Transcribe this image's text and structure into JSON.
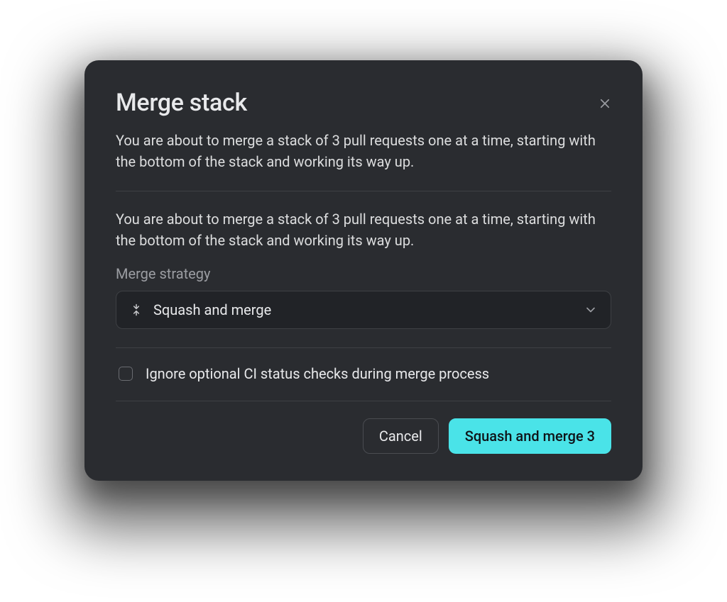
{
  "modal": {
    "title": "Merge stack",
    "description_top": "You are about to merge a stack of 3 pull requests one at a time, starting with the bottom of the stack and working its way up.",
    "description_mid": "You are about to merge a stack of 3 pull requests one at a time, starting with the bottom of the stack and working its way up.",
    "strategy_label": "Merge strategy",
    "strategy_selected": "Squash and merge",
    "checkbox_label": "Ignore optional CI status checks during merge process",
    "cancel_label": "Cancel",
    "confirm_label": "Squash and merge 3"
  },
  "colors": {
    "accent": "#4ae3e8",
    "bg_modal": "#2a2c30",
    "bg_select": "#212327",
    "text_primary": "#e8e9eb",
    "text_muted": "#9b9da2",
    "border": "#3e4044"
  }
}
